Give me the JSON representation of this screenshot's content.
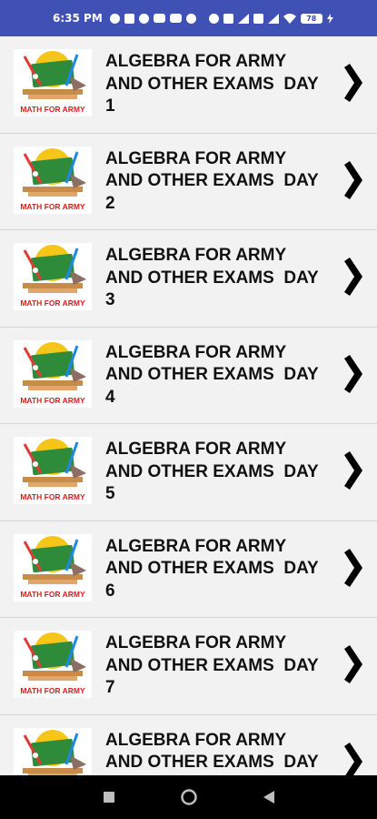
{
  "status_bar": {
    "time": "6:35 PM",
    "battery": "78",
    "icons_left": [
      "settings-icon",
      "sim-icon",
      "facebook-icon",
      "youtube-icon",
      "youtube-icon",
      "whatsapp-icon"
    ],
    "icons_right": [
      "alarm-icon",
      "volte-icon",
      "signal-icon",
      "volte-icon",
      "signal-icon",
      "wifi-icon",
      "battery-icon",
      "charging-icon"
    ]
  },
  "list": {
    "thumbnail_label": "MATH FOR ARMY",
    "items": [
      {
        "title_line1": "ALGEBRA FOR ARMY",
        "title_line2": "AND OTHER EXAMS  DAY",
        "title_line3": "1"
      },
      {
        "title_line1": "ALGEBRA FOR ARMY",
        "title_line2": "AND OTHER EXAMS  DAY",
        "title_line3": "2"
      },
      {
        "title_line1": "ALGEBRA FOR ARMY",
        "title_line2": "AND OTHER EXAMS  DAY",
        "title_line3": "3"
      },
      {
        "title_line1": "ALGEBRA FOR ARMY",
        "title_line2": "AND OTHER EXAMS  DAY",
        "title_line3": "4"
      },
      {
        "title_line1": "ALGEBRA FOR ARMY",
        "title_line2": "AND OTHER EXAMS  DAY",
        "title_line3": "5"
      },
      {
        "title_line1": "ALGEBRA FOR ARMY",
        "title_line2": "AND OTHER EXAMS  DAY",
        "title_line3": "6"
      },
      {
        "title_line1": "ALGEBRA FOR ARMY",
        "title_line2": "AND OTHER EXAMS  DAY",
        "title_line3": "7"
      },
      {
        "title_line1": "ALGEBRA FOR ARMY",
        "title_line2": "AND OTHER EXAMS  DAY",
        "title_line3": ""
      }
    ]
  },
  "nav_bar": {
    "buttons": [
      "recents-icon",
      "home-icon",
      "back-icon"
    ]
  },
  "colors": {
    "status_bar": "#3f51b5",
    "list_bg": "#f2f2f2",
    "divider": "#d6d6d6",
    "thumb_label": "#e01b1b",
    "text": "#111111"
  }
}
